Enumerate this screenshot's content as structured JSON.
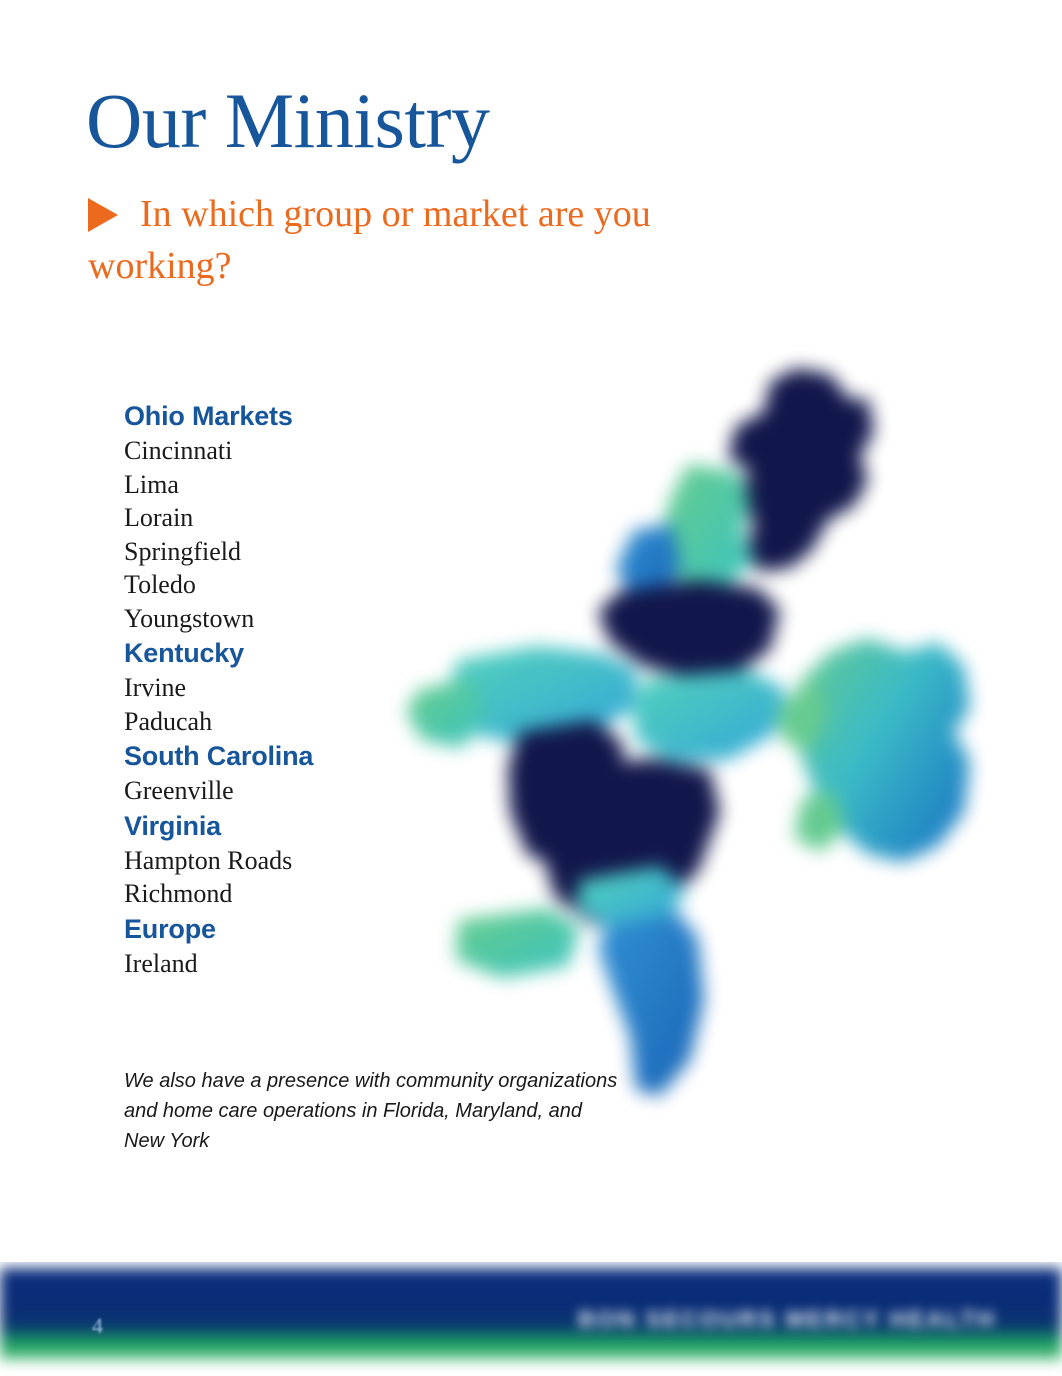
{
  "page": {
    "title": "Our Ministry",
    "subtitle": "In which group or market are you working?",
    "bullet_icon": "triangle-right-icon",
    "background_color": "#ffffff"
  },
  "colors": {
    "title_blue": "#17569B",
    "accent_orange": "#EB6A1E",
    "header_blue": "#17569B",
    "body_text": "#1a1a1a",
    "footer_blue": "#0A2C77",
    "footer_green": "#1C9C62",
    "page_number": "#9FC0E2"
  },
  "markets": [
    {
      "header": "Ohio Markets",
      "items": [
        "Cincinnati",
        "Lima",
        "Lorain",
        "Springfield",
        "Toledo",
        "Youngstown"
      ]
    },
    {
      "header": "Kentucky",
      "items": [
        "Irvine",
        "Paducah"
      ]
    },
    {
      "header": "South Carolina",
      "items": [
        "Greenville"
      ]
    },
    {
      "header": "Virginia",
      "items": [
        "Hampton Roads",
        "Richmond"
      ]
    },
    {
      "header": "Europe",
      "items": [
        "Ireland"
      ]
    }
  ],
  "caption": "We also have a presence with community organizations and home care operations in Florida, Maryland, and New York",
  "map": {
    "name": "eastern-us-and-ireland-map",
    "description": "Blurred stylized map of the eastern United States with Ireland shown at right",
    "region_colors": [
      "#0B1046",
      "#1164B5",
      "#2BA8D6",
      "#3FD0C0",
      "#56C98A",
      "#6FD28F"
    ]
  },
  "footer": {
    "page_number": "4",
    "logo_text": "BON SECOURS MERCY HEALTH"
  }
}
